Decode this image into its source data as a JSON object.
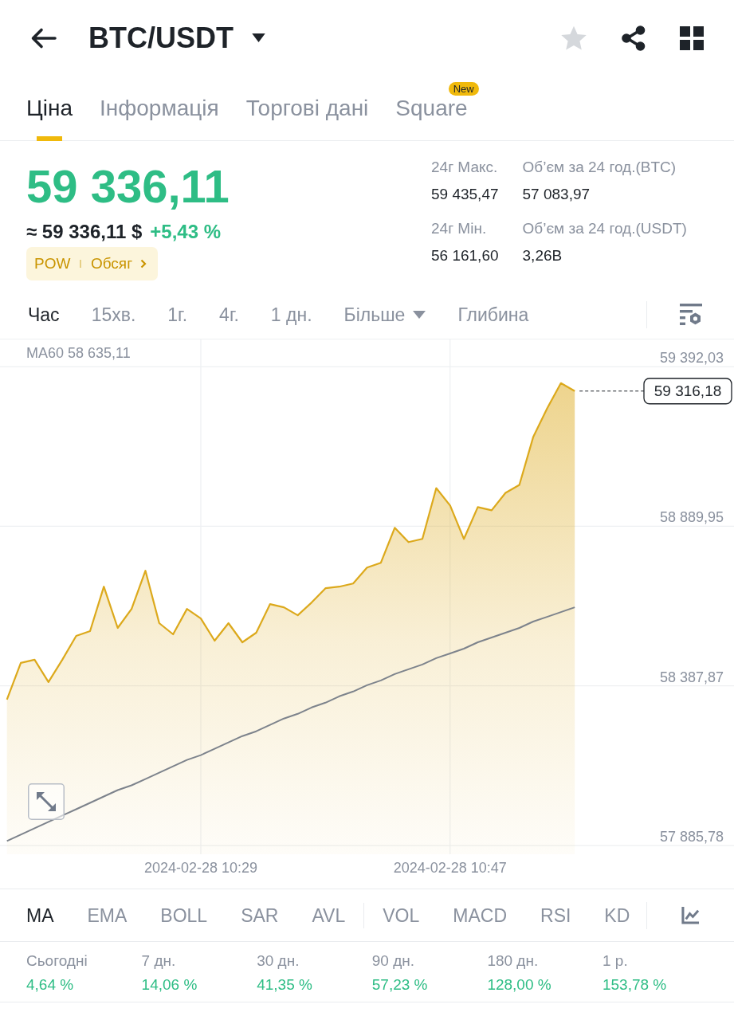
{
  "header": {
    "title": "BTC/USDT",
    "favorite": false
  },
  "tabs": [
    {
      "label": "Ціна",
      "selected": true
    },
    {
      "label": "Інформація",
      "selected": false
    },
    {
      "label": "Торгові дані",
      "selected": false
    },
    {
      "label": "Square",
      "selected": false,
      "badge": "New"
    }
  ],
  "price": {
    "last": "59 336,11",
    "approx": "≈ 59 336,11 $",
    "change": "+5,43 %",
    "tags": [
      {
        "label": "POW",
        "kind": "tag"
      },
      {
        "label": "Обсяг",
        "kind": "link"
      }
    ]
  },
  "stats": [
    {
      "label": "24г Макс.",
      "value": "59 435,47"
    },
    {
      "label": "Об’єм за 24 год.(BTC)",
      "value": "57 083,97"
    },
    {
      "label": "24г Мін.",
      "value": "56 161,60"
    },
    {
      "label": "Об’єм за 24 год.(USDT)",
      "value": "3,26B"
    }
  ],
  "intervals": [
    {
      "label": "Час",
      "selected": true,
      "kind": "interval"
    },
    {
      "label": "15хв.",
      "selected": false,
      "kind": "interval"
    },
    {
      "label": "1г.",
      "selected": false,
      "kind": "interval"
    },
    {
      "label": "4г.",
      "selected": false,
      "kind": "interval"
    },
    {
      "label": "1 дн.",
      "selected": false,
      "kind": "interval"
    },
    {
      "label": "Більше",
      "selected": false,
      "kind": "menu"
    },
    {
      "label": "Глибина",
      "selected": false,
      "kind": "interval"
    }
  ],
  "chart": {
    "ma_label": "MA60 58 635,11",
    "last_price_label": "59 316,18",
    "chart_data": {
      "type": "area",
      "grid": true,
      "categories": [
        null,
        null,
        null,
        null,
        null,
        null,
        null,
        null,
        null,
        null,
        null,
        null,
        null,
        null,
        "2024-02-28 10:29",
        null,
        null,
        null,
        null,
        null,
        null,
        null,
        null,
        null,
        null,
        null,
        null,
        null,
        null,
        null,
        null,
        null,
        "2024-02-28 10:47",
        null,
        null,
        null,
        null,
        null,
        null,
        null,
        null,
        null,
        null,
        null,
        null,
        null,
        null,
        null,
        null,
        null,
        null,
        null,
        null
      ],
      "ylim": [
        57337,
        60545
      ],
      "yticks": [
        {
          "value": 59392.03,
          "label": "59 392,03"
        },
        {
          "value": 58889.95,
          "label": "58 889,95"
        },
        {
          "value": 58387.87,
          "label": "58 387,87"
        },
        {
          "value": 57885.78,
          "label": "57 885,78"
        }
      ],
      "series": [
        {
          "color": "#dca91c",
          "values": [
            58345,
            58460,
            58470,
            58400,
            58470,
            58545,
            58560,
            58700,
            58570,
            58630,
            58750,
            58585,
            58550,
            58630,
            58600,
            58530,
            58585,
            58525,
            58555,
            58645,
            58635,
            58610,
            58650,
            58695,
            58700,
            58710,
            58760,
            58775,
            58885,
            58840,
            58850,
            59010,
            58955,
            58850,
            58950,
            58940,
            58995,
            59020,
            59170,
            59260,
            59340,
            59315,
            null,
            null,
            null,
            null,
            null,
            null,
            null,
            null,
            null,
            null,
            null
          ]
        },
        {
          "type": "line",
          "color": "#7d838c",
          "values": [
            57900,
            57920,
            57940,
            57960,
            57980,
            58000,
            58020,
            58040,
            58060,
            58075,
            58095,
            58115,
            58135,
            58155,
            58170,
            58190,
            58210,
            58230,
            58245,
            58265,
            58285,
            58300,
            58320,
            58335,
            58355,
            58370,
            58390,
            58405,
            58425,
            58440,
            58455,
            58475,
            58490,
            58505,
            58525,
            58540,
            58555,
            58570,
            58590,
            58605,
            58620,
            58635,
            null,
            null,
            null,
            null,
            null,
            null,
            null,
            null,
            null,
            null,
            null
          ]
        }
      ]
    }
  },
  "main_indicators": [
    {
      "label": "MA",
      "selected": true
    },
    {
      "label": "EMA",
      "selected": false
    },
    {
      "label": "BOLL",
      "selected": false
    },
    {
      "label": "SAR",
      "selected": false
    },
    {
      "label": "AVL",
      "selected": false
    }
  ],
  "sub_indicators": [
    {
      "label": "VOL",
      "selected": false
    },
    {
      "label": "MACD",
      "selected": false
    },
    {
      "label": "RSI",
      "selected": false
    },
    {
      "label": "KD",
      "selected": false
    }
  ],
  "performance": [
    {
      "period": "Сьогодні",
      "change": "4,64 %"
    },
    {
      "period": "7 дн.",
      "change": "14,06 %"
    },
    {
      "period": "30 дн.",
      "change": "41,35 %"
    },
    {
      "period": "90 дн.",
      "change": "57,23 %"
    },
    {
      "period": "180 дн.",
      "change": "128,00 %"
    },
    {
      "period": "1 р.",
      "change": "153,78 %"
    }
  ]
}
